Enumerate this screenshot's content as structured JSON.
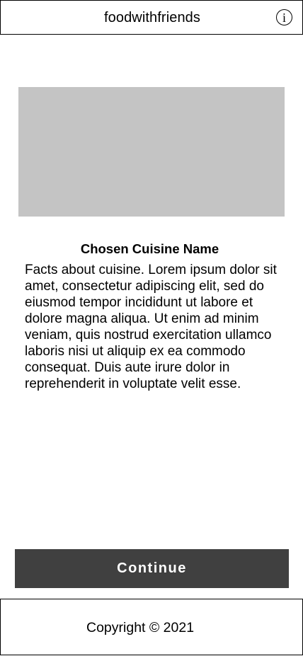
{
  "header": {
    "title": "foodwithfriends",
    "info_icon_glyph": "i"
  },
  "main": {
    "cuisine_name": "Chosen Cuisine Name",
    "cuisine_facts": "Facts about cuisine. Lorem ipsum dolor sit amet, consectetur adipiscing elit, sed do eiusmod tempor incididunt ut labore et dolore magna aliqua. Ut enim ad minim veniam, quis nostrud exercitation ullamco laboris nisi ut aliquip ex ea commodo consequat. Duis aute irure dolor in reprehenderit in voluptate velit esse."
  },
  "actions": {
    "continue_label": "Continue"
  },
  "footer": {
    "copyright": "Copyright © 2021"
  },
  "colors": {
    "image_placeholder": "#c4c4c4",
    "button_background": "#404040",
    "button_text": "#ffffff",
    "border": "#000000"
  }
}
